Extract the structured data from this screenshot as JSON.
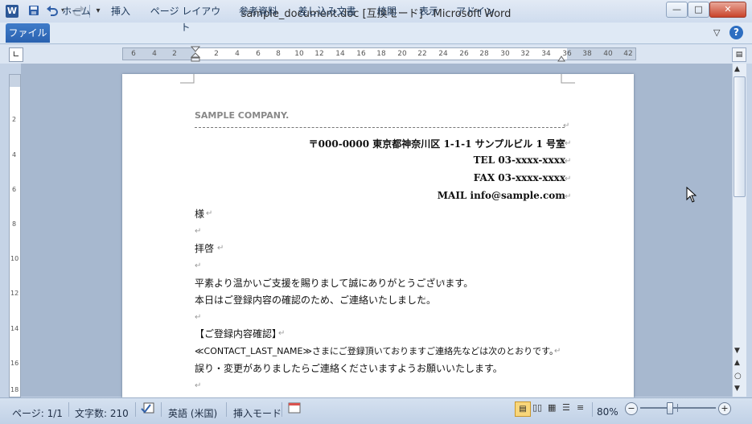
{
  "window": {
    "title": "sample_document.doc [互換モード] - Microsoft Word",
    "app_icon": "W",
    "controls": {
      "minimize": "—",
      "maximize": "□",
      "close": "✕"
    }
  },
  "qat": {
    "save": "save-icon",
    "undo": "undo-icon",
    "redo": "redo-icon",
    "customize": "▾"
  },
  "ribbon": {
    "tabs": [
      "ファイル",
      "ホーム",
      "挿入",
      "ページ レイアウト",
      "参考資料",
      "差し込み文書",
      "校閲",
      "表示",
      "アドイン"
    ],
    "minimize": "▽",
    "help": "?"
  },
  "ruler": {
    "ticks": [
      "6",
      "4",
      "2",
      "2",
      "4",
      "6",
      "8",
      "10",
      "12",
      "14",
      "16",
      "18",
      "20",
      "22",
      "24",
      "26",
      "28",
      "30",
      "32",
      "34",
      "36",
      "38",
      "40",
      "42"
    ],
    "tab_selector": "∟"
  },
  "vruler": {
    "ticks": [
      "2",
      "4",
      "6",
      "8",
      "10",
      "12",
      "14",
      "16",
      "18"
    ]
  },
  "document": {
    "company": "SAMPLE COMPANY.",
    "address": "〒000-0000 東京都神奈川区 1-1-1 サンプルビル 1 号室",
    "tel": "TEL 03-xxxx-xxxx",
    "fax": "FAX 03-xxxx-xxxx",
    "mail": "MAIL info@sample.com",
    "recipient": "様",
    "greeting": "拝啓",
    "line1": "平素より温かいご支援を賜りまして誠にありがとうございます。",
    "line2": "本日はご登録内容の確認のため、ご連絡いたしました。",
    "section_title": "【ご登録内容確認】",
    "line3": "≪CONTACT_LAST_NAME≫さまにご登録頂いておりますご連絡先などは次のとおりです。",
    "line4": "誤り・変更がありましたらご連絡くださいますようお願いいたします。",
    "para_mark": "↵"
  },
  "status": {
    "page": "ページ: 1/1",
    "words": "文字数: 210",
    "language": "英語 (米国)",
    "mode": "挿入モード",
    "zoom": "80%",
    "zoom_minus": "−",
    "zoom_plus": "+",
    "zoom_level_fraction": 0.8
  }
}
